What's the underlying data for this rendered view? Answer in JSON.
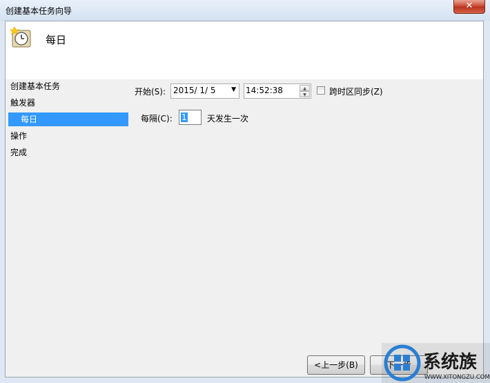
{
  "window": {
    "title": "创建基本任务向导",
    "close_glyph": "✕"
  },
  "header": {
    "title": "每日",
    "icon": "scheduled-task-clock-icon"
  },
  "nav": {
    "items": [
      "创建基本任务",
      "触发器",
      "每日",
      "操作",
      "完成"
    ],
    "selected": "每日"
  },
  "form": {
    "start_label": "开始(S):",
    "start_date": "2015/  1/  5",
    "start_time": "14:52:38",
    "sync_timezone_label": "跨时区同步(Z)",
    "sync_timezone_checked": false,
    "recur_label": "每隔(C):",
    "recur_value": "1",
    "recur_suffix": "天发生一次"
  },
  "buttons": {
    "back": "<上一步(B)",
    "next": "下一步"
  },
  "watermark": {
    "text": "系统族",
    "url": "WWW.XITONGZU.COM"
  }
}
